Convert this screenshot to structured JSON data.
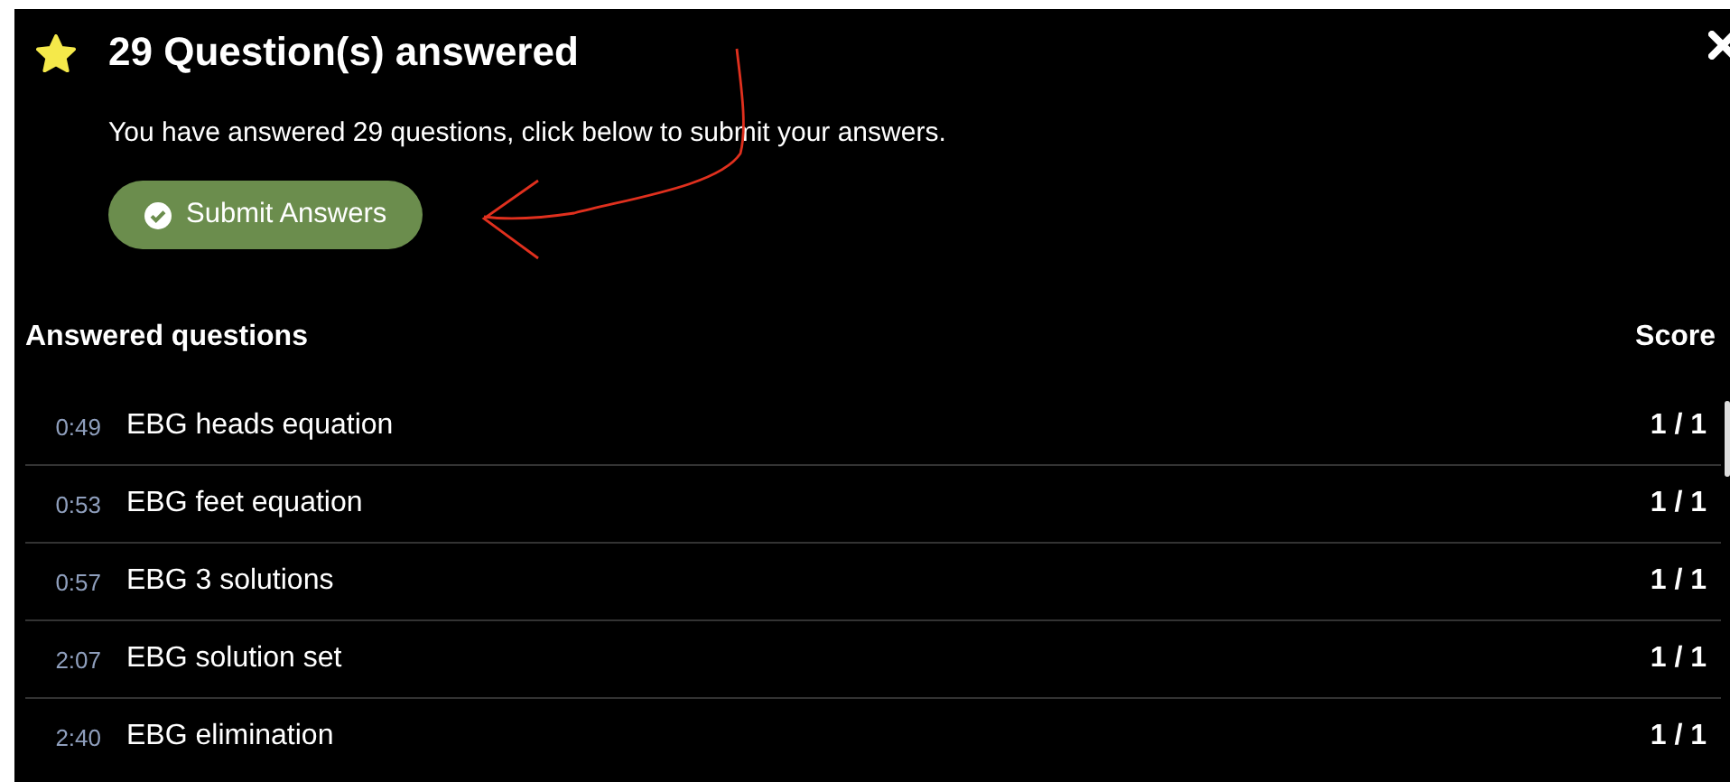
{
  "dialog": {
    "title": "29 Question(s) answered",
    "message": "You have answered 29 questions, click below to submit your answers.",
    "submit_button": "Submit Answers"
  },
  "answered": {
    "heading": "Answered questions",
    "score_heading": "Score",
    "rows": [
      {
        "time": "0:49",
        "name": "EBG heads equation",
        "score": "1 / 1"
      },
      {
        "time": "0:53",
        "name": "EBG feet equation",
        "score": "1 / 1"
      },
      {
        "time": "0:57",
        "name": "EBG 3 solutions",
        "score": "1 / 1"
      },
      {
        "time": "2:07",
        "name": "EBG solution set",
        "score": "1 / 1"
      },
      {
        "time": "2:40",
        "name": "EBG elimination",
        "score": "1 / 1"
      }
    ]
  }
}
